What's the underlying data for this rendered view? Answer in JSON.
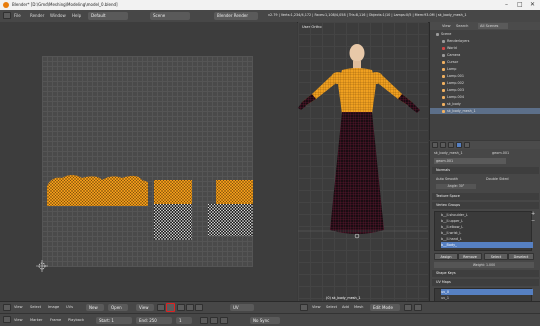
{
  "window": {
    "title": "Blender* [D:\\Gmd\\Meshing\\Modeling\\model_0.blend]",
    "controls": [
      "–",
      "□",
      "✕"
    ]
  },
  "menubar": {
    "menus": [
      "File",
      "Render",
      "Window",
      "Help"
    ],
    "layout": "Default",
    "scene": "Scene",
    "engine": "Blender Render",
    "info": "v2.79 | Verts:1,234/4,172 | Faces:1,108/4,058 | Tris:8,116 | Objects:1/10 | Lamps:0/5 | Mem:93.0M | sk_body_mesh_1"
  },
  "uv_editor": {
    "header_menus": [
      "View",
      "Select",
      "Image",
      "UVs"
    ],
    "new_label": "New",
    "open_label": "Open",
    "view_label": "View",
    "pivot_label": "UV",
    "cursor_icon": "plus-icon",
    "islands_color": "#f09a1a"
  },
  "view3d": {
    "label": "User Ortho",
    "object_label": "(0) sk_body_mesh_1",
    "header_menus": [
      "View",
      "Select",
      "Add",
      "Mesh"
    ],
    "mode": "Edit Mode",
    "pivot": "Global"
  },
  "outliner": {
    "header": [
      "View",
      "Search",
      "All Scenes"
    ],
    "items": [
      {
        "label": "Scene",
        "indent": 0,
        "color": "#9a9a9a"
      },
      {
        "label": "Renderlayers",
        "indent": 1,
        "color": "#9a9a9a"
      },
      {
        "label": "World",
        "indent": 1,
        "color": "#d24545"
      },
      {
        "label": "Camera",
        "indent": 1,
        "color": "#9a9a9a"
      },
      {
        "label": "Cursor",
        "indent": 1,
        "color": "#f0b060"
      },
      {
        "label": "Lamp",
        "indent": 1,
        "color": "#f0b060"
      },
      {
        "label": "Lamp.001",
        "indent": 1,
        "color": "#f0b060"
      },
      {
        "label": "Lamp.002",
        "indent": 1,
        "color": "#f0b060"
      },
      {
        "label": "Lamp.003",
        "indent": 1,
        "color": "#f0b060"
      },
      {
        "label": "Lamp.004",
        "indent": 1,
        "color": "#f0b060"
      },
      {
        "label": "sk_body",
        "indent": 1,
        "color": "#f0b060"
      },
      {
        "label": "sk_body_mesh_1",
        "indent": 1,
        "color": "#f0b060",
        "selected": true
      }
    ]
  },
  "properties": {
    "object_path": "sk_body_mesh_1",
    "mesh_name": "geom.001",
    "data_name": "geom.001",
    "sections": {
      "normals": "Normals",
      "auto_smooth": "Auto Smooth",
      "double_sided": "Double Sided",
      "angle": "Angle: 30°",
      "texture_space": "Texture Space",
      "vertex_groups": "Vertex Groups",
      "shape_keys": "Shape Keys",
      "uv_maps": "UV Maps"
    },
    "vertex_groups": [
      {
        "label": "b__ll.shoulder_L",
        "selected": false
      },
      {
        "label": "b__ll.upper_L",
        "selected": false
      },
      {
        "label": "b__ll.elbow_L",
        "selected": false
      },
      {
        "label": "b__ll.wrist_L",
        "selected": false
      },
      {
        "label": "b__ll.hand_L",
        "selected": false
      },
      {
        "label": "b__Body_",
        "selected": true
      }
    ],
    "vg_buttons": [
      "Assign",
      "Remove",
      "Select",
      "Deselect"
    ],
    "weight": "Weight: 1.000",
    "uv_maps": [
      {
        "label": "uv_0",
        "selected": true
      },
      {
        "label": "uv_1",
        "selected": false
      }
    ]
  },
  "bottom": {
    "row1": [
      "View",
      "Select",
      "Add",
      "Mesh",
      "Edit Mode"
    ],
    "row2": [
      "View",
      "Marker",
      "Frame",
      "Playback",
      "Start: 1",
      "End: 250",
      "1",
      "No Sync"
    ]
  }
}
